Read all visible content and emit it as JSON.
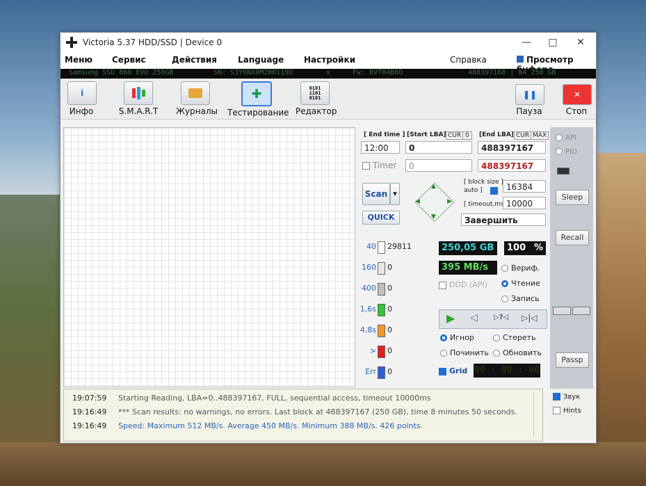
{
  "window": {
    "title": "Victoria 5.37 HDD/SSD | Device 0",
    "minimize": "—",
    "maximize": "□",
    "close": "✕"
  },
  "menu": {
    "items": [
      "Меню",
      "Сервис",
      "Действия",
      "Language",
      "Настройки"
    ],
    "help": "Справка",
    "buffer_view": "Просмотр буфера"
  },
  "device": {
    "model": "Samsung SSD 860 EVO 250GB",
    "serial": "SN: S3Y9NX0M200119D",
    "close": "x",
    "firmware": "Fw: RVT04B6Q",
    "lba": "488397168 | 84 250 GB"
  },
  "toolbar": {
    "info": "Инфо",
    "smart": "S.M.A.R.T",
    "logs": "Журналы",
    "test": "Тестирование",
    "editor": "Редактор",
    "pause": "Пауза",
    "stop": "Стоп"
  },
  "scan": {
    "end_time_label": "[ End time ]",
    "start_lba_label": "[Start LBA]",
    "cur_label": "CUR",
    "cur_value": "0",
    "end_lba_label": "[End LBA]",
    "cur2_label": "CUR",
    "max_label": "MAX",
    "end_time": "12:00",
    "start_lba": "0",
    "end_lba": "488397167",
    "timer_label": "Timer",
    "timer_value": "0",
    "end_lba2": "488397167",
    "scan_button": "Scan",
    "quick_button": "QUICK",
    "block_size_label": "[ block size ]",
    "auto_label": "auto ]",
    "block_size": "16384",
    "timeout_label": "[ timeout,ms ]",
    "timeout": "10000",
    "finish_action": "Завершить"
  },
  "stats": {
    "rows": [
      {
        "label": "40",
        "count": "29811",
        "color": "#ffffff"
      },
      {
        "label": "160",
        "count": "0",
        "color": "#e8e8e8"
      },
      {
        "label": "400",
        "count": "0",
        "color": "#bfbfbf"
      },
      {
        "label": "1,6s",
        "count": "0",
        "color": "#36c436"
      },
      {
        "label": "4,8s",
        "count": "0",
        "color": "#f09a2a"
      },
      {
        "label": ">",
        "count": "0",
        "color": "#e02020"
      },
      {
        "label": "Err",
        "count": "0",
        "color": "#2f5fd0"
      }
    ],
    "size": "250,05 GB",
    "percent": "100",
    "percent_sign": "%",
    "speed": "395 MB/s",
    "ddd_label": "DDD (API)",
    "verify": "Вериф.",
    "read": "Чтение",
    "write": "Запись",
    "ignore": "Игнор",
    "erase": "Стереть",
    "repair": "Починить",
    "refresh": "Обновить",
    "grid_label": "Grid",
    "grid_time": "00 : 00 : 00"
  },
  "side": {
    "api": "API",
    "pio": "PIO",
    "sleep": "Sleep",
    "recall": "Recall",
    "passp": "Passp",
    "sound": "Звук",
    "hints": "Hints"
  },
  "log": [
    {
      "time": "19:07:59",
      "text": "Starting Reading, LBA=0..488397167, FULL, sequential access, timeout 10000ms",
      "color": "#555555"
    },
    {
      "time": "19:16:49",
      "text": "*** Scan results: no warnings, no errors. Last block at 488397167 (250 GB), time 8 minutes 50 seconds.",
      "color": "#555555"
    },
    {
      "time": "19:16:49",
      "text": "Speed: Maximum 512 MB/s. Average 450 MB/s. Minimum 388 MB/s. 426 points.",
      "color": "#2a64b8"
    }
  ]
}
